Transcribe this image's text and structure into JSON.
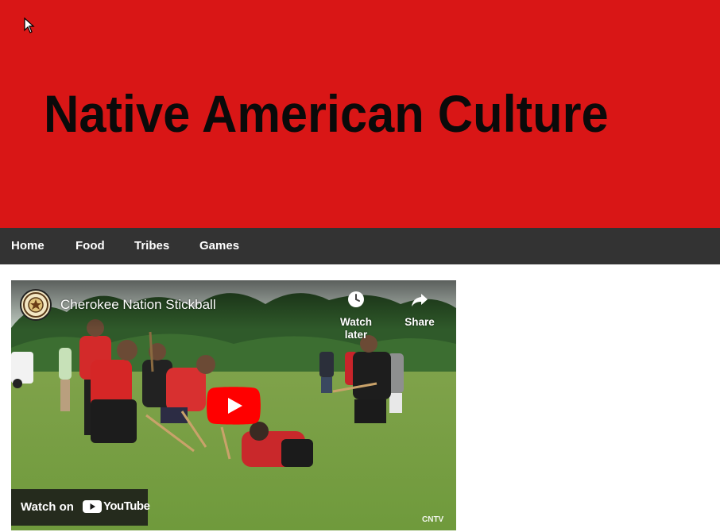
{
  "site": {
    "title": "Native American Culture",
    "header_color": "#d91616"
  },
  "nav": {
    "items": [
      {
        "label": "Home"
      },
      {
        "label": "Food"
      },
      {
        "label": "Tribes"
      },
      {
        "label": "Games"
      }
    ]
  },
  "video": {
    "title": "Cherokee Nation Stickball",
    "watch_later_label": "Watch later",
    "share_label": "Share",
    "watch_on_label": "Watch on",
    "youtube_label": "YouTube",
    "watermark": "CNTV",
    "play_button_color": "#ff0000",
    "icons": {
      "watch_later": "clock-icon",
      "share": "share-arrow-icon",
      "play": "play-icon",
      "youtube": "youtube-logo-icon"
    }
  }
}
